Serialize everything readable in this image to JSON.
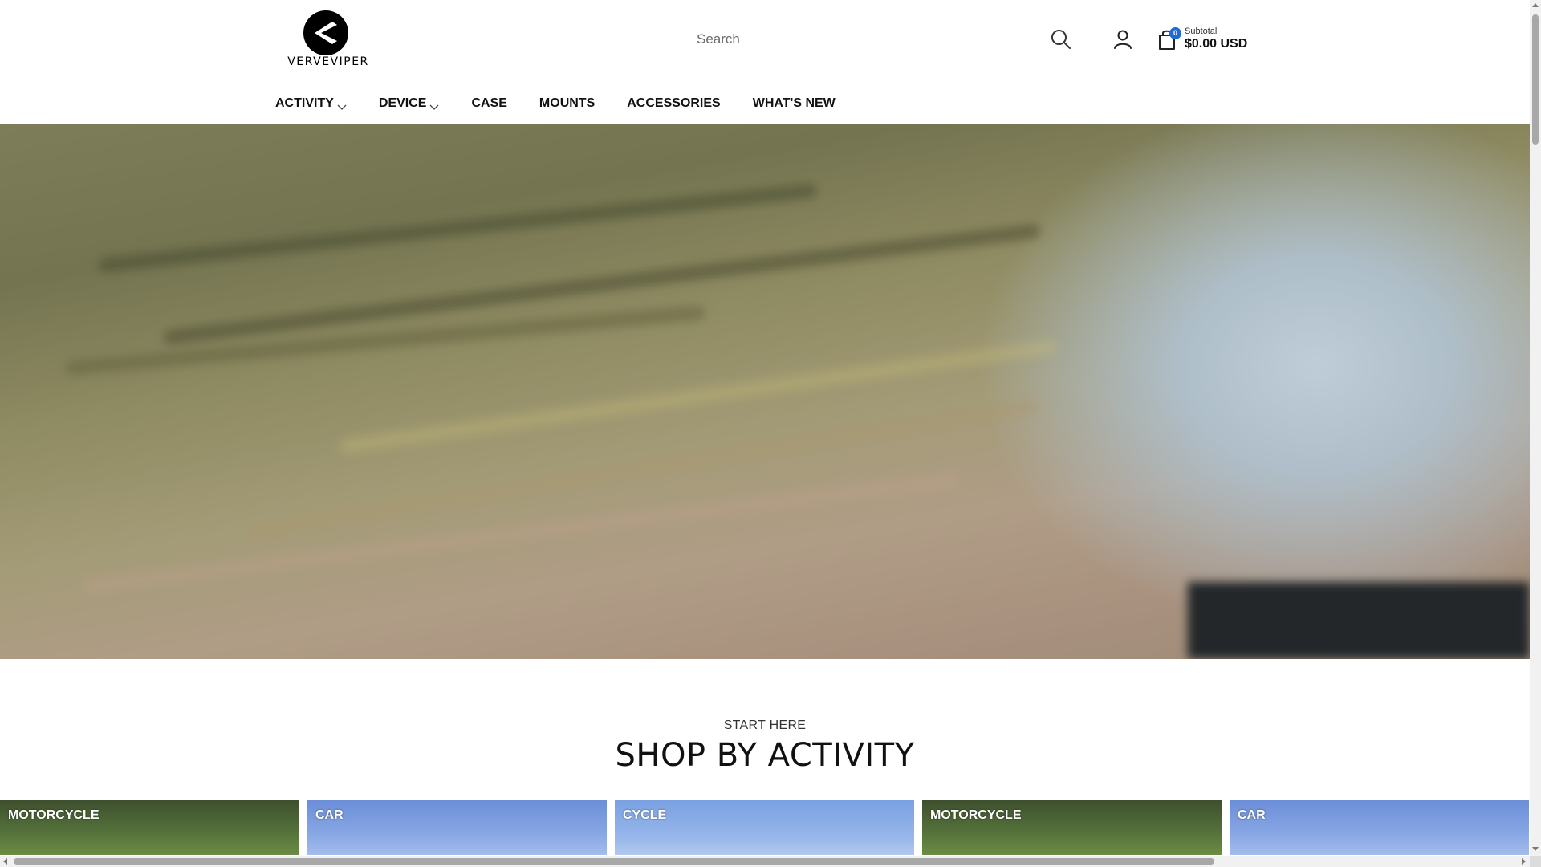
{
  "brand": {
    "logo_text": "VERVEVIPER"
  },
  "search": {
    "placeholder": "Search"
  },
  "cart": {
    "count": "0",
    "subtotal_label": "Subtotal",
    "subtotal_value": "$0.00 USD"
  },
  "nav": {
    "items": [
      {
        "label": "ACTIVITY",
        "has_dropdown": true
      },
      {
        "label": "DEVICE",
        "has_dropdown": true
      },
      {
        "label": "CASE",
        "has_dropdown": false
      },
      {
        "label": "MOUNTS",
        "has_dropdown": false
      },
      {
        "label": "ACCESSORIES",
        "has_dropdown": false
      },
      {
        "label": "WHAT'S NEW",
        "has_dropdown": false
      }
    ]
  },
  "shop": {
    "eyebrow": "START HERE",
    "title": "SHOP BY ACTIVITY",
    "cards": [
      {
        "label": "MOTORCYCLE"
      },
      {
        "label": "CAR"
      },
      {
        "label": "CYCLE"
      },
      {
        "label": "MOTORCYCLE"
      },
      {
        "label": "CAR"
      }
    ]
  },
  "icons": {
    "search": "search-icon",
    "account": "user-icon",
    "cart": "shopping-bag-icon",
    "dropdown": "chevron-down-icon"
  },
  "colors": {
    "accent": "#1e6bd6",
    "text": "#111111"
  }
}
